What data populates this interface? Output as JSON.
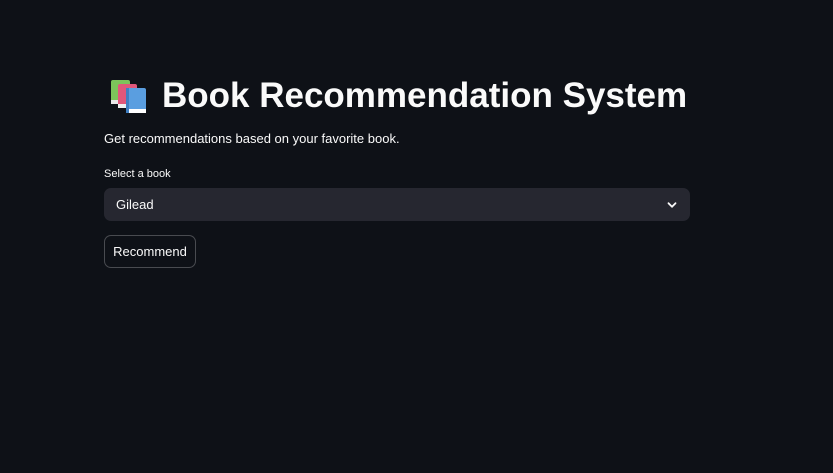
{
  "header": {
    "icon": "books-icon",
    "title": "Book Recommendation System"
  },
  "subtitle": "Get recommendations based on your favorite book.",
  "book_select": {
    "label": "Select a book",
    "selected_value": "Gilead",
    "icon": "chevron-down-icon"
  },
  "recommend_button": {
    "label": "Recommend"
  },
  "colors": {
    "background": "#0e1117",
    "select_background": "#262730",
    "text": "#fafafa"
  }
}
